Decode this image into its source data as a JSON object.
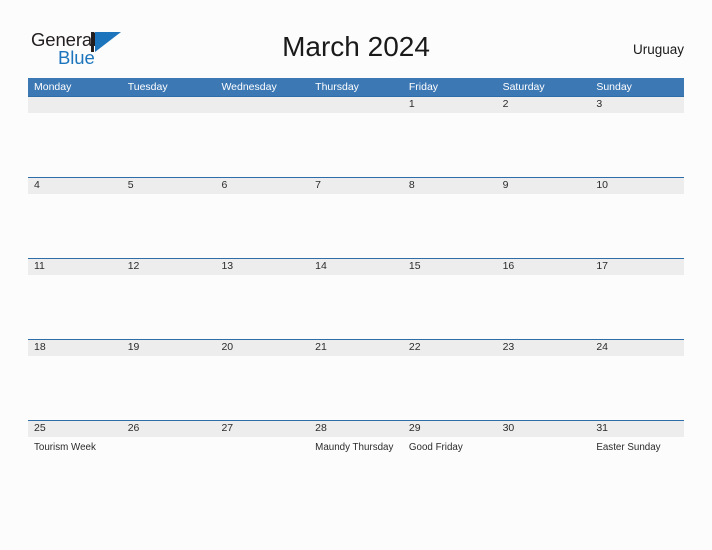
{
  "logo": {
    "word_top": "General",
    "word_bottom": "Blue",
    "mark": "triangle-mark",
    "color_dark": "#231F20",
    "color_blue": "#1C75BC"
  },
  "header": {
    "title": "March 2024",
    "country": "Uruguay"
  },
  "theme": {
    "header_blue": "#3C78B4",
    "band_gray": "#EDEDED",
    "rule_blue": "#2E6DA8",
    "page_bg": "#FCFCFD",
    "text": "#2B2B2B"
  },
  "calendar": {
    "month": "March",
    "year": "2024",
    "weekday_headers": [
      "Monday",
      "Tuesday",
      "Wednesday",
      "Thursday",
      "Friday",
      "Saturday",
      "Sunday"
    ],
    "weeks": [
      [
        {
          "day": "",
          "event": ""
        },
        {
          "day": "",
          "event": ""
        },
        {
          "day": "",
          "event": ""
        },
        {
          "day": "",
          "event": ""
        },
        {
          "day": "1",
          "event": ""
        },
        {
          "day": "2",
          "event": ""
        },
        {
          "day": "3",
          "event": ""
        }
      ],
      [
        {
          "day": "4",
          "event": ""
        },
        {
          "day": "5",
          "event": ""
        },
        {
          "day": "6",
          "event": ""
        },
        {
          "day": "7",
          "event": ""
        },
        {
          "day": "8",
          "event": ""
        },
        {
          "day": "9",
          "event": ""
        },
        {
          "day": "10",
          "event": ""
        }
      ],
      [
        {
          "day": "11",
          "event": ""
        },
        {
          "day": "12",
          "event": ""
        },
        {
          "day": "13",
          "event": ""
        },
        {
          "day": "14",
          "event": ""
        },
        {
          "day": "15",
          "event": ""
        },
        {
          "day": "16",
          "event": ""
        },
        {
          "day": "17",
          "event": ""
        }
      ],
      [
        {
          "day": "18",
          "event": ""
        },
        {
          "day": "19",
          "event": ""
        },
        {
          "day": "20",
          "event": ""
        },
        {
          "day": "21",
          "event": ""
        },
        {
          "day": "22",
          "event": ""
        },
        {
          "day": "23",
          "event": ""
        },
        {
          "day": "24",
          "event": ""
        }
      ],
      [
        {
          "day": "25",
          "event": "Tourism Week"
        },
        {
          "day": "26",
          "event": ""
        },
        {
          "day": "27",
          "event": ""
        },
        {
          "day": "28",
          "event": "Maundy Thursday"
        },
        {
          "day": "29",
          "event": "Good Friday"
        },
        {
          "day": "30",
          "event": ""
        },
        {
          "day": "31",
          "event": "Easter Sunday"
        }
      ]
    ]
  }
}
